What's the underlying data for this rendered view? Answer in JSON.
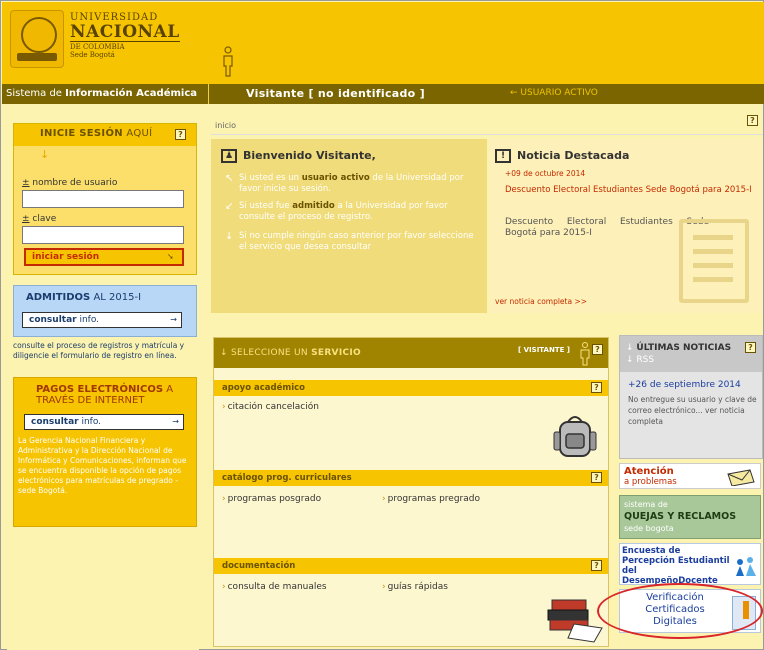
{
  "header": {
    "logo_line1": "UNIVERSIDAD",
    "logo_line2": "NACIONAL",
    "logo_line3": "DE COLOMBIA",
    "logo_line4": "Sede Bogotá"
  },
  "navbar": {
    "system_prefix": "Sistema de",
    "system_name": "Información Académica",
    "visitor": "Visitante [ no identificado ]",
    "active_user": "← USUARIO ACTIVO"
  },
  "login": {
    "title_bold": "INICIE SESIÓN",
    "title_rest": " AQUÍ",
    "username_label": "nombre de usuario",
    "username_value": "",
    "password_label": "clave",
    "password_value": "",
    "submit_label": "iniciar sesión"
  },
  "admitidos": {
    "title_bold": "ADMITIDOS",
    "title_rest": " AL 2015-I",
    "button_bold": "consultar",
    "button_rest": " info.",
    "description": "consulte el proceso de registros y matrícula y diligencie el formulario de registro en línea."
  },
  "pagos": {
    "title_bold": "PAGOS ELECTRÓNICOS",
    "title_rest": " A TRAVÉS DE INTERNET",
    "button_bold": "consultar",
    "button_rest": " info.",
    "description": "La Gerencia Nacional Financiera y Administrativa y la Dirección Nacional de Informática y Comunicaciones, informan que se encuentra disponible la opción de pagos electrónicos para matrículas de pregrado - sede Bogotá."
  },
  "breadcrumb": "inicio",
  "welcome": {
    "title": "Bienvenido Visitante,",
    "item1_a": "Si usted es un ",
    "item1_b": "usuario activo",
    "item1_c": " de la Universidad por favor inicie su sesión.",
    "item2_a": "Si usted fue ",
    "item2_b": "admitido",
    "item2_c": " a la Universidad por favor consulte el proceso de registro.",
    "item3": "Si no cumple ningún caso anterior por favor seleccione el servicio que desea consultar"
  },
  "news": {
    "title": "Noticia Destacada",
    "date": "+09 de octubre 2014",
    "link": "Descuento Electoral Estudiantes Sede Bogotá para 2015-I",
    "body": "Descuento Electoral Estudiantes Sede Bogotá para 2015-I",
    "more": "ver noticia completa >>"
  },
  "services": {
    "title_prefix": "SELECCIONE UN",
    "title_bold": "SERVICIO",
    "tag": "[ VISITANTE ]",
    "sections": [
      {
        "title": "apoyo académico",
        "links": [
          "citación cancelación"
        ]
      },
      {
        "title": "catálogo prog. curriculares",
        "links": [
          "programas posgrado",
          "programas pregrado"
        ]
      },
      {
        "title": "documentación",
        "links": [
          "consulta de manuales",
          "guías rápidas"
        ]
      }
    ]
  },
  "ultimas": {
    "title_bold": "ÚLTIMAS NOTICIAS",
    "subtitle": "RSS",
    "date": "+26 de septiembre 2014",
    "text": "No entregue su usuario y clave de correo electrónico... ver noticia completa"
  },
  "atencion": {
    "title": "Atención",
    "subtitle": "a problemas"
  },
  "quejas": {
    "line1": "sistema de",
    "line2": "QUEJAS Y RECLAMOS",
    "line3": "sede bogota"
  },
  "encuesta": {
    "text": "Encuesta de Percepción Estudiantil del DesempeñoDocente"
  },
  "verificacion": {
    "line1": "Verificación",
    "line2": "Certificados",
    "line3": "Digitales"
  },
  "colors": {
    "header_yellow": "#f6c400",
    "navbar_brown": "#7a6500",
    "accent_red": "#c42a00",
    "link_blue": "#1a3d9e",
    "highlight_red": "#d8262a"
  }
}
